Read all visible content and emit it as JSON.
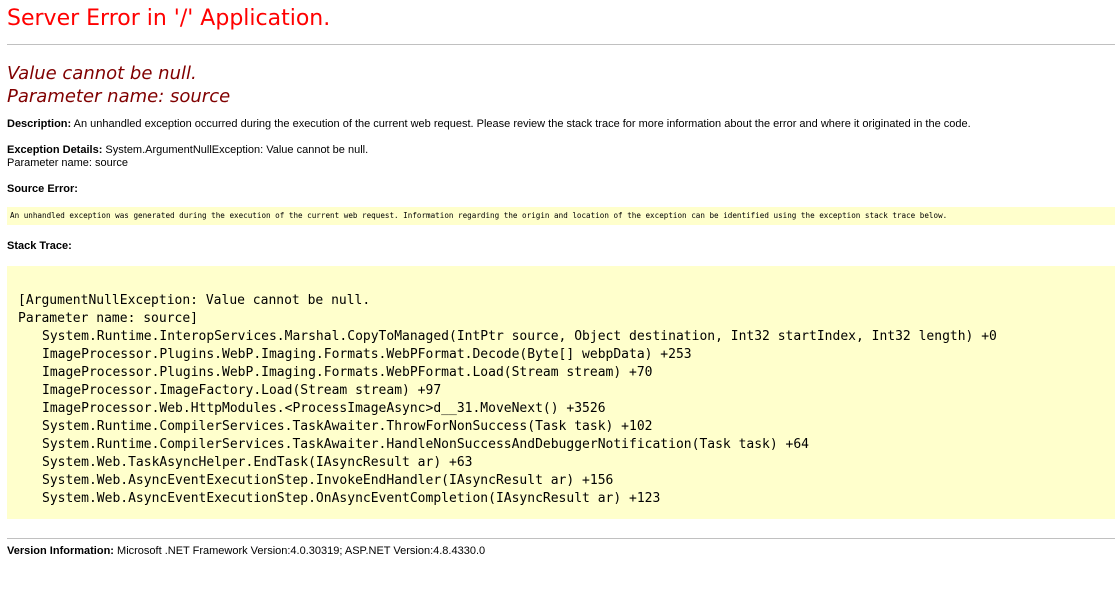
{
  "title": "Server Error in '/' Application.",
  "message_line1": "Value cannot be null.",
  "message_line2": "Parameter name: source",
  "description": {
    "label": "Description:",
    "text": "An unhandled exception occurred during the execution of the current web request. Please review the stack trace for more information about the error and where it originated in the code."
  },
  "exception_details": {
    "label": "Exception Details:",
    "text": "System.ArgumentNullException: Value cannot be null.",
    "text2": "Parameter name: source"
  },
  "source_error": {
    "label": "Source Error:",
    "text": "An unhandled exception was generated during the execution of the current web request. Information regarding the origin and location of the exception can be identified using the exception stack trace below."
  },
  "stack_trace": {
    "label": "Stack Trace:",
    "header1": "[ArgumentNullException: Value cannot be null.",
    "header2": "Parameter name: source]",
    "frames": [
      "System.Runtime.InteropServices.Marshal.CopyToManaged(IntPtr source, Object destination, Int32 startIndex, Int32 length) +0",
      "ImageProcessor.Plugins.WebP.Imaging.Formats.WebPFormat.Decode(Byte[] webpData) +253",
      "ImageProcessor.Plugins.WebP.Imaging.Formats.WebPFormat.Load(Stream stream) +70",
      "ImageProcessor.ImageFactory.Load(Stream stream) +97",
      "ImageProcessor.Web.HttpModules.<ProcessImageAsync>d__31.MoveNext() +3526",
      "System.Runtime.CompilerServices.TaskAwaiter.ThrowForNonSuccess(Task task) +102",
      "System.Runtime.CompilerServices.TaskAwaiter.HandleNonSuccessAndDebuggerNotification(Task task) +64",
      "System.Web.TaskAsyncHelper.EndTask(IAsyncResult ar) +63",
      "System.Web.AsyncEventExecutionStep.InvokeEndHandler(IAsyncResult ar) +156",
      "System.Web.AsyncEventExecutionStep.OnAsyncEventCompletion(IAsyncResult ar) +123"
    ]
  },
  "version_info": {
    "label": "Version Information:",
    "text": "Microsoft .NET Framework Version:4.0.30319; ASP.NET Version:4.8.4330.0"
  },
  "colors": {
    "title": "#ff0000",
    "message": "#800000",
    "code_background": "#ffffcc",
    "rule": "#c0c0c0"
  }
}
